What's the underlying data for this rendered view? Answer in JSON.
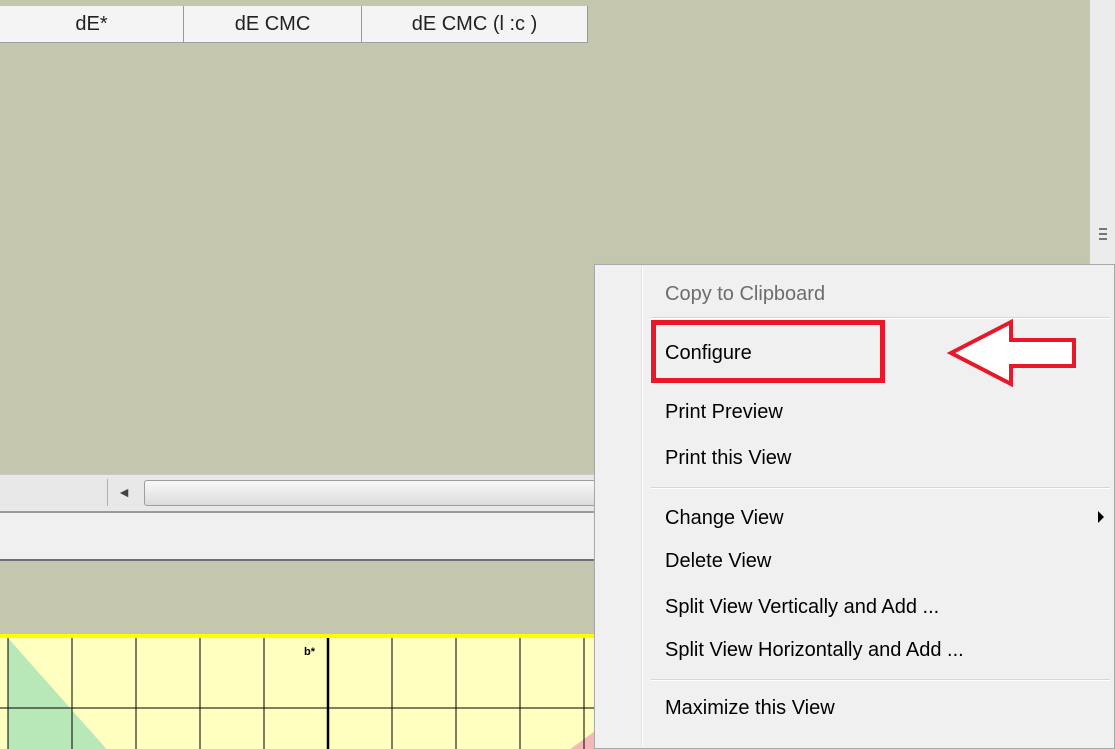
{
  "table": {
    "columns": [
      "dE*",
      "dE CMC",
      "dE CMC (l :c )"
    ]
  },
  "chart": {
    "axis_label": "b*"
  },
  "context_menu": {
    "items": [
      {
        "label": "Copy to Clipboard",
        "enabled": false
      },
      {
        "label": "Configure",
        "enabled": true
      },
      {
        "label": "Print Preview",
        "enabled": true
      },
      {
        "label": "Print this View",
        "enabled": true
      },
      {
        "label": "Change View",
        "enabled": true,
        "submenu": true
      },
      {
        "label": "Delete View",
        "enabled": true
      },
      {
        "label": "Split View Vertically and Add ...",
        "enabled": true
      },
      {
        "label": "Split View Horizontally and Add ...",
        "enabled": true
      },
      {
        "label": "Maximize this View",
        "enabled": true
      }
    ]
  },
  "annotation": {
    "highlight_color": "#e8182a",
    "highlighted_item": "Configure"
  },
  "colors": {
    "background": "#c4c6ae",
    "chart_fill": "#ffffc0",
    "chart_border": "#ffff00",
    "menu_bg": "#f0f0f0"
  }
}
